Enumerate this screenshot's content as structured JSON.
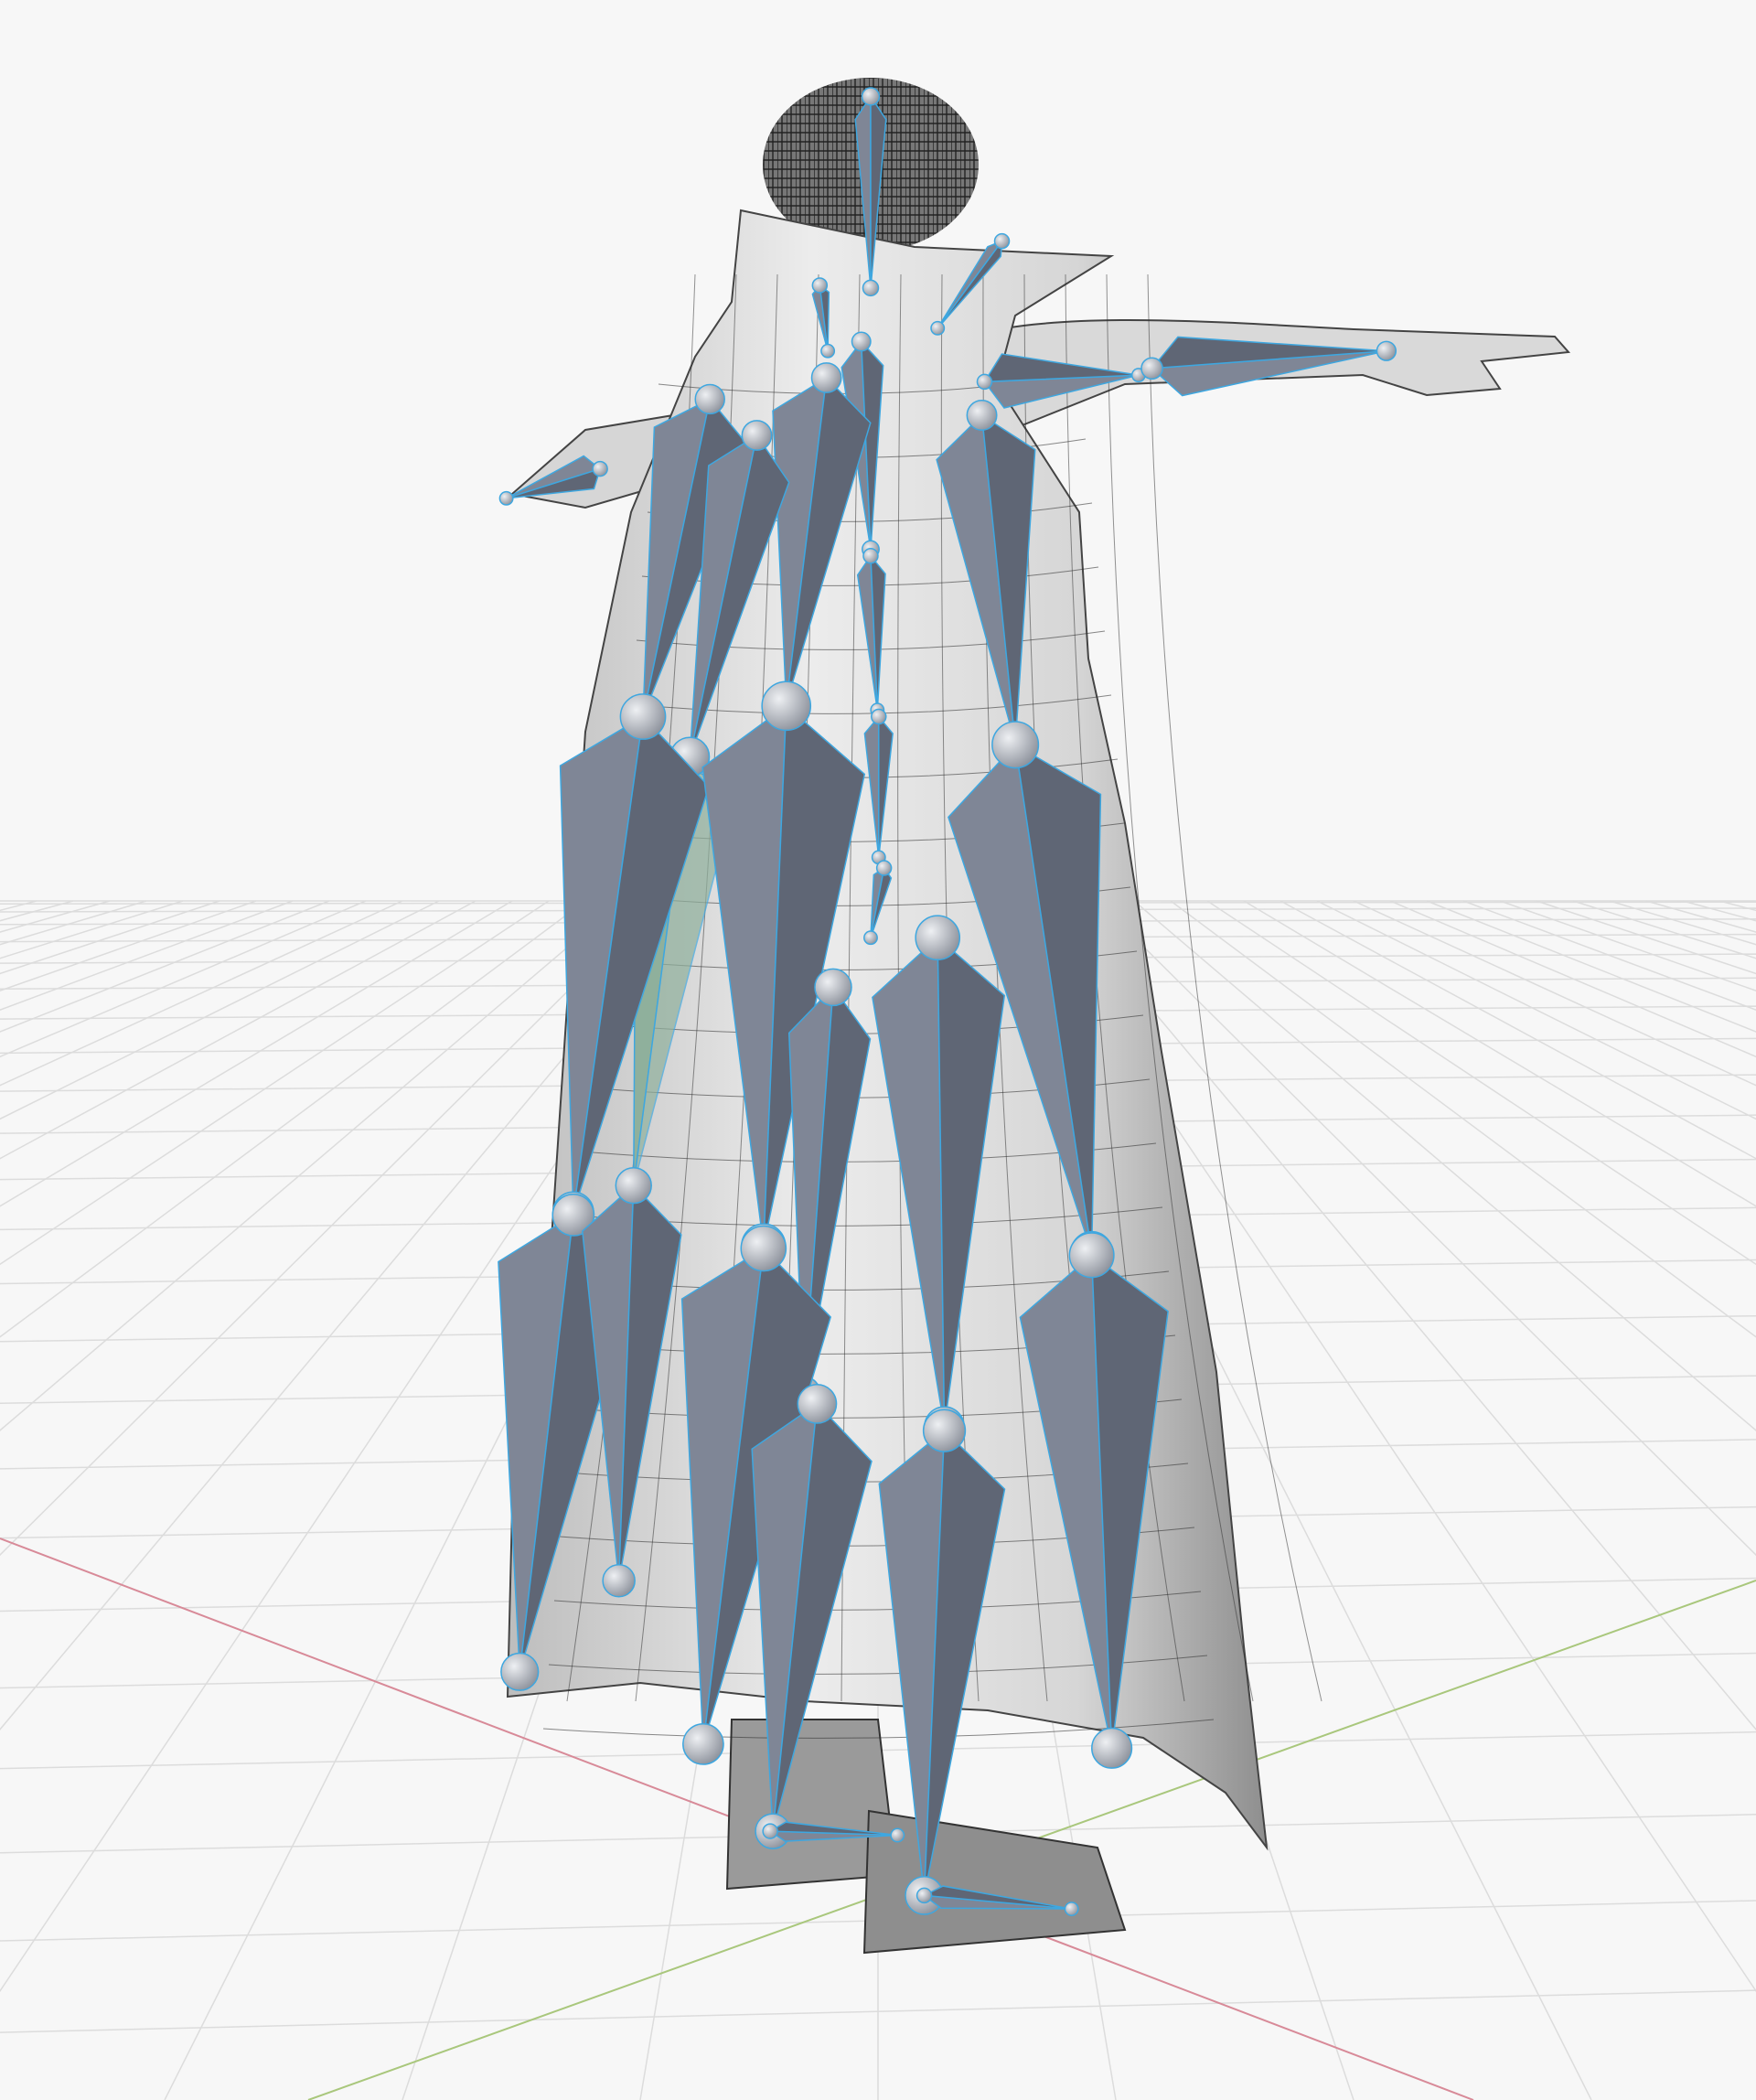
{
  "viewport": {
    "background": "#f7f7f7",
    "grid": "#dcdcdc",
    "x_axis_color": "#d88a98",
    "y_axis_color": "#a9c77c",
    "mesh_light": "#e4e4e4",
    "mesh_shade": "#a9a9a9",
    "wire": "#2a2a2a",
    "bone_fill": "#7f8696",
    "bone_dark": "#5f6675",
    "bone_outline": "#3ea7e0",
    "joint_fill": "#c9ccd2",
    "active_bone": "#8fb09c"
  }
}
